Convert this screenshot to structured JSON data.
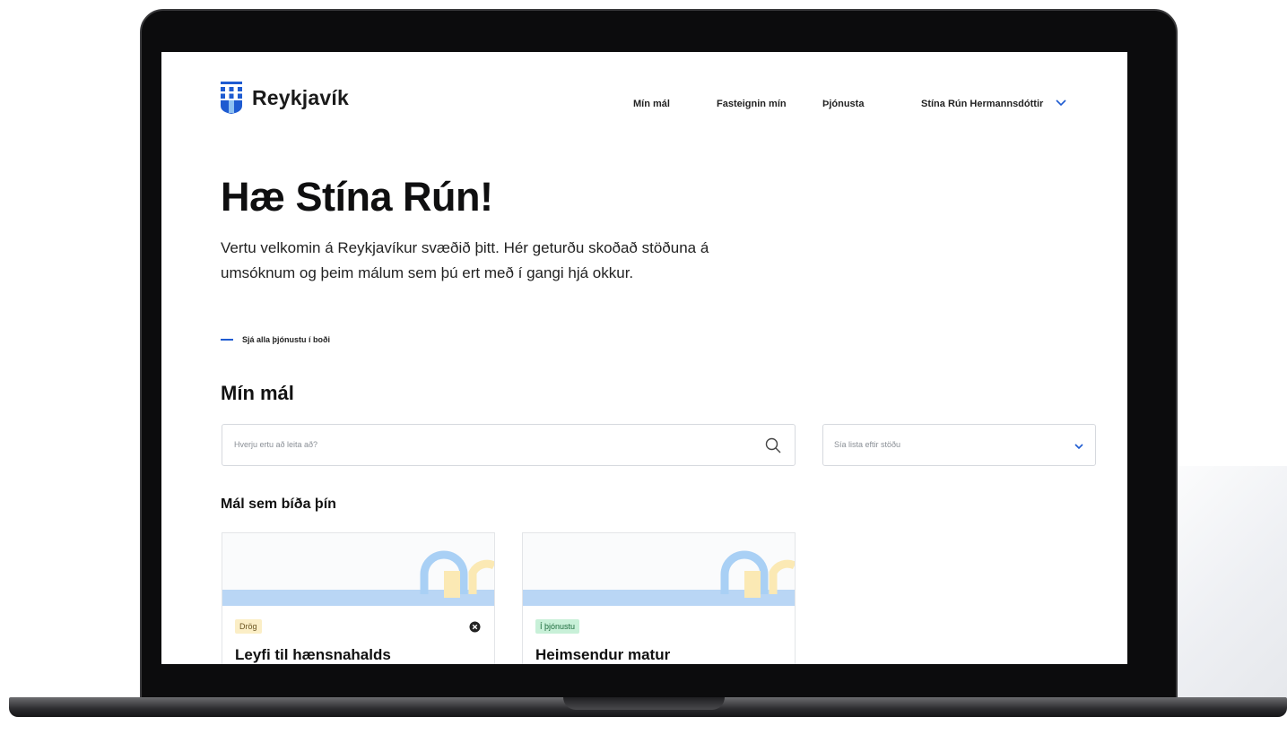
{
  "header": {
    "logo_text": "Reykjavík",
    "nav": [
      "Mín mál",
      "Fasteignin mín",
      "Þjónusta"
    ],
    "user_name": "Stína Rún Hermannsdóttir"
  },
  "hero": {
    "title": "Hæ Stína Rún!",
    "text": "Vertu velkomin á Reykjavíkur svæðið þitt. Hér geturðu skoðað stöðuna á umsóknum og þeim málum sem þú ert með í gangi hjá okkur.",
    "link": "Sjá alla þjónustu í boði"
  },
  "cases": {
    "title": "Mín mál",
    "search_placeholder": "Hverju ertu að leita að?",
    "filter_placeholder": "Sía lista eftir stöðu",
    "waiting_title": "Mál sem bíða þín",
    "items": [
      {
        "status": "Drög",
        "title": "Leyfi til hænsnahalds"
      },
      {
        "status": "Í þjónustu",
        "title": "Heimsendur matur"
      }
    ]
  },
  "colors": {
    "brand_blue": "#1e5bd1",
    "band_blue": "#b9d6f5",
    "draft_badge": "#fbeec6",
    "service_badge": "#c8f0d8"
  }
}
